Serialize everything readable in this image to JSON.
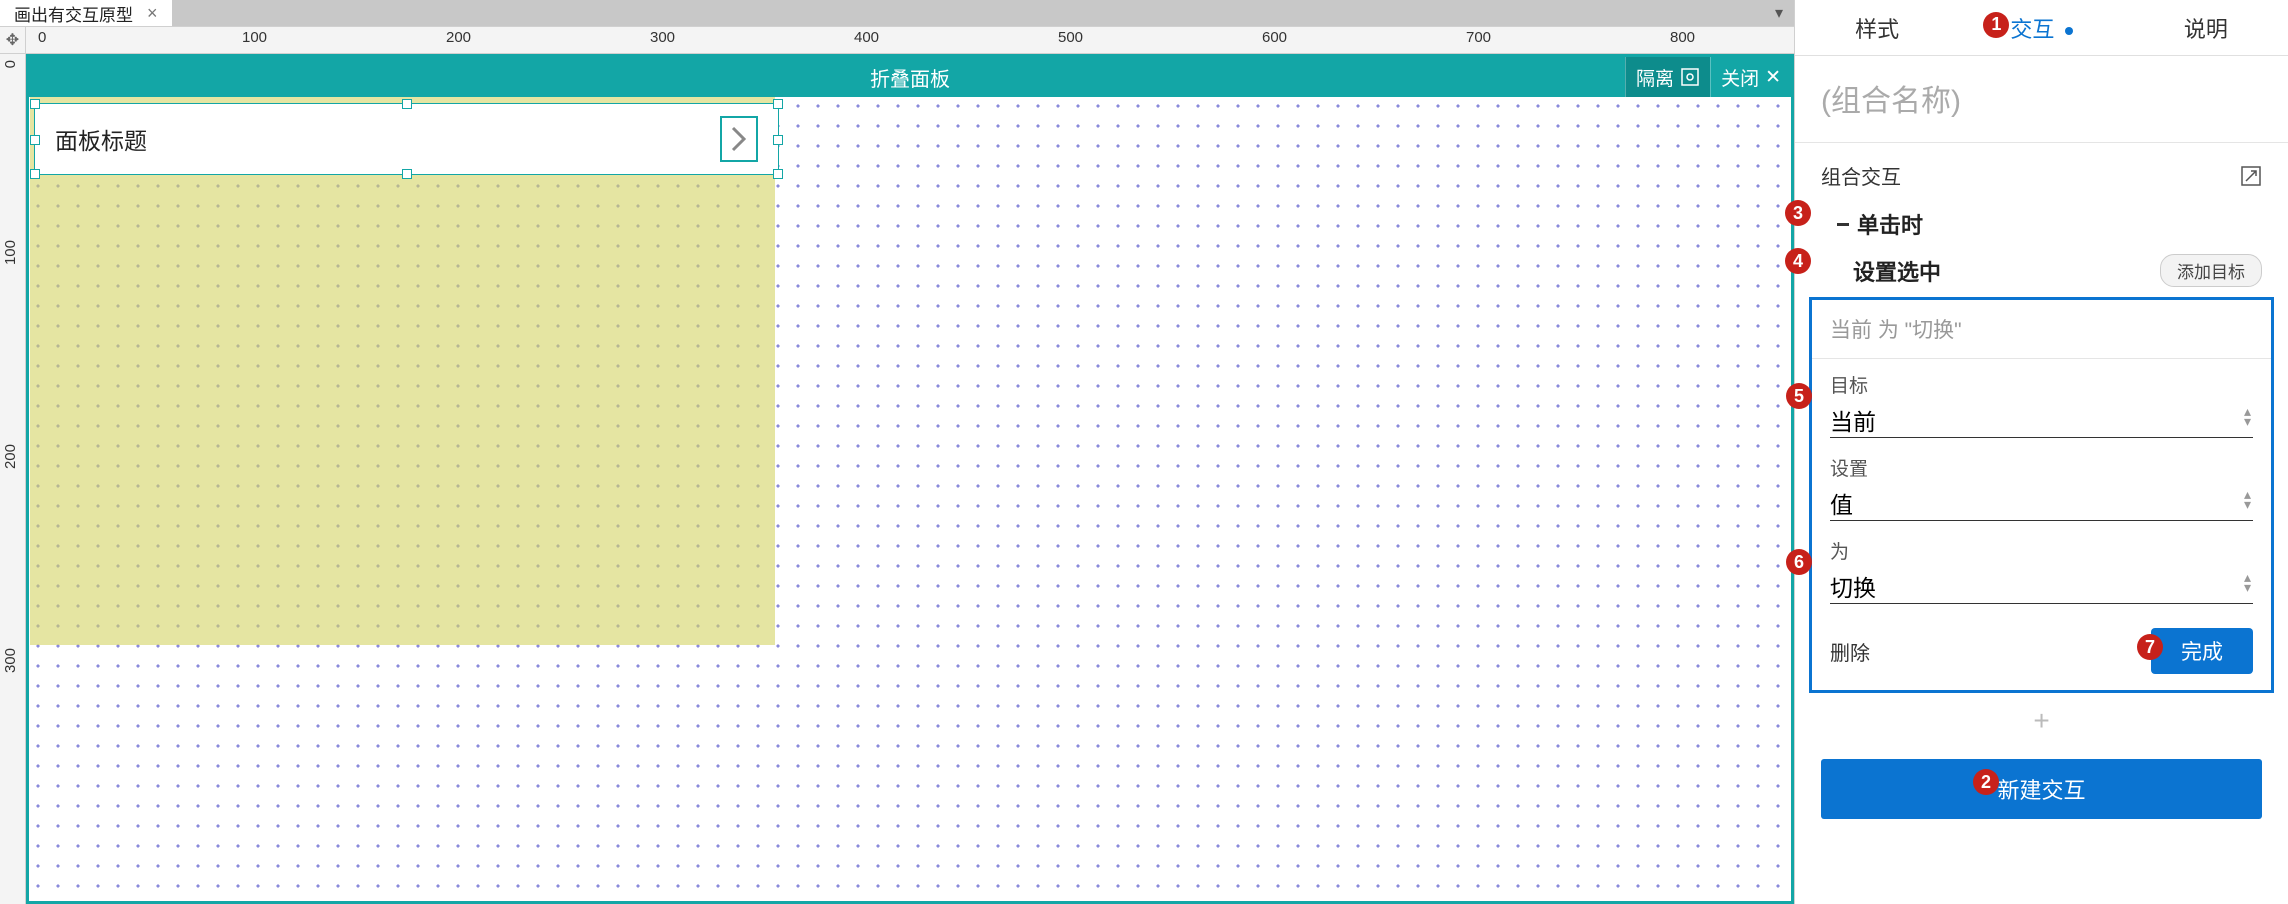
{
  "tab": {
    "title": "画出有交互原型"
  },
  "ruler": {
    "h_labels": [
      "0",
      "100",
      "200",
      "300",
      "400",
      "500",
      "600",
      "700",
      "800"
    ],
    "v_labels": [
      "0",
      "100",
      "200",
      "300"
    ]
  },
  "canvas_editor": {
    "title": "折叠面板",
    "isolate": "隔离",
    "close": "关闭",
    "widget_title": "面板标题"
  },
  "inspector": {
    "tabs": {
      "style": "样式",
      "interact": "交互",
      "notes": "说明"
    },
    "group_placeholder": "(组合名称)",
    "section_title": "组合交互",
    "event": "单击时",
    "action": "设置选中",
    "add_target": "添加目标",
    "config": {
      "description": "当前 为 \"切换\"",
      "target_label": "目标",
      "target_value": "当前",
      "set_label": "设置",
      "set_value": "值",
      "to_label": "为",
      "to_value": "切换",
      "delete": "删除",
      "done": "完成"
    },
    "new_interaction": "新建交互"
  },
  "annotations": {
    "1": "1",
    "2": "2",
    "3": "3",
    "4": "4",
    "5": "5",
    "6": "6",
    "7": "7"
  }
}
